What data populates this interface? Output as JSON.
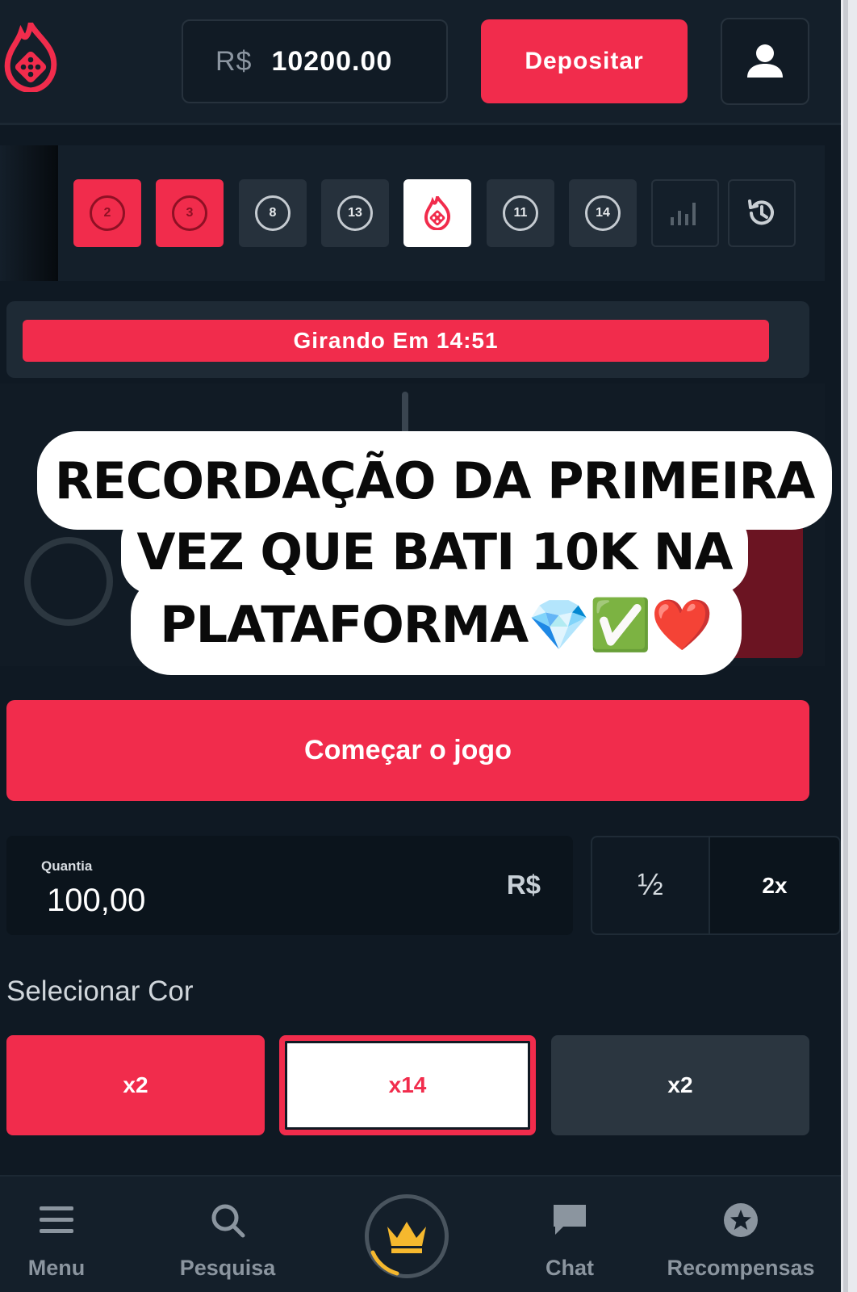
{
  "header": {
    "balance_currency": "R$",
    "balance_value": "10200.00",
    "deposit_label": "Depositar"
  },
  "history": {
    "results": [
      {
        "label": "2",
        "color": "red"
      },
      {
        "label": "3",
        "color": "red"
      },
      {
        "label": "8",
        "color": "black"
      },
      {
        "label": "13",
        "color": "black"
      },
      {
        "label": "",
        "color": "white",
        "icon": "blaze-logo-icon"
      },
      {
        "label": "11",
        "color": "black"
      },
      {
        "label": "14",
        "color": "black"
      }
    ],
    "stats_icon": "bar-chart-icon",
    "history_icon": "history-icon"
  },
  "game": {
    "timer_text": "Girando Em 14:51"
  },
  "overlay": {
    "line1": "RECORDAÇÃO DA PRIMEIRA",
    "line2": "VEZ QUE BATI 10K NA",
    "line3": "PLATAFORMA💎✅❤️"
  },
  "controls": {
    "start_label": "Começar o jogo",
    "amount_label": "Quantia",
    "amount_value": "100,00",
    "amount_currency": "R$",
    "half_label": "½",
    "double_label": "2x",
    "select_color_title": "Selecionar Cor",
    "colors": [
      {
        "label": "x2",
        "color": "#f12c4c"
      },
      {
        "label": "x14",
        "color": "#ffffff"
      },
      {
        "label": "x2",
        "color": "#2b3640"
      }
    ]
  },
  "nav": {
    "items": [
      {
        "label": "Menu",
        "icon": "menu-icon"
      },
      {
        "label": "Pesquisa",
        "icon": "search-icon"
      },
      {
        "label": "",
        "icon": "crown-icon"
      },
      {
        "label": "Chat",
        "icon": "chat-icon"
      },
      {
        "label": "Recompensas",
        "icon": "star-badge-icon"
      }
    ]
  },
  "colors": {
    "accent": "#f12c4c",
    "background": "#0f1923",
    "panel": "#141f2a"
  }
}
